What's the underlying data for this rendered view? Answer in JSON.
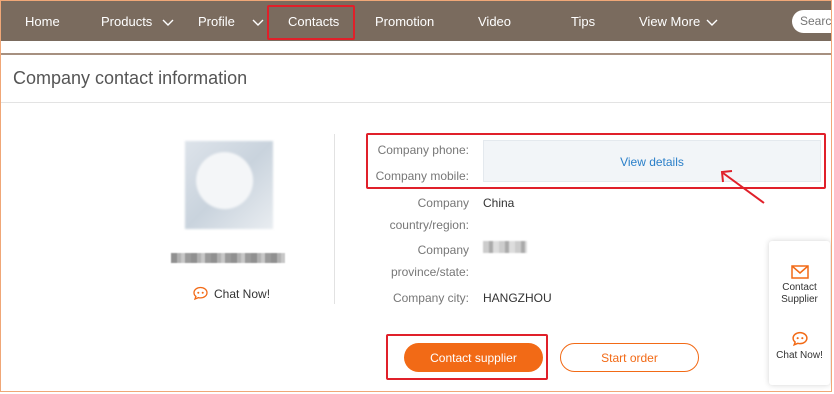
{
  "nav": {
    "items": [
      "Home",
      "Products",
      "Profile",
      "Contacts",
      "Promotion",
      "Video",
      "Tips",
      "View More"
    ],
    "search_placeholder": "Search"
  },
  "page": {
    "title": "Company contact information"
  },
  "supplier": {
    "chat_label": "Chat Now!"
  },
  "contact": {
    "phone_label": "Company phone:",
    "mobile_label": "Company mobile:",
    "view_details": "View details",
    "country_label_1": "Company",
    "country_label_2": "country/region:",
    "country_value": "China",
    "province_label_1": "Company",
    "province_label_2": "province/state:",
    "city_label": "Company city:",
    "city_value": "HANGZHOU"
  },
  "actions": {
    "contact_supplier": "Contact supplier",
    "start_order": "Start order"
  },
  "side_widget": {
    "contact_line1": "Contact",
    "contact_line2": "Supplier",
    "chat": "Chat Now!"
  },
  "colors": {
    "nav_bg": "#7a6b5e",
    "accent": "#f26a16",
    "link": "#2a7fc9",
    "highlight": "#e0202a"
  }
}
